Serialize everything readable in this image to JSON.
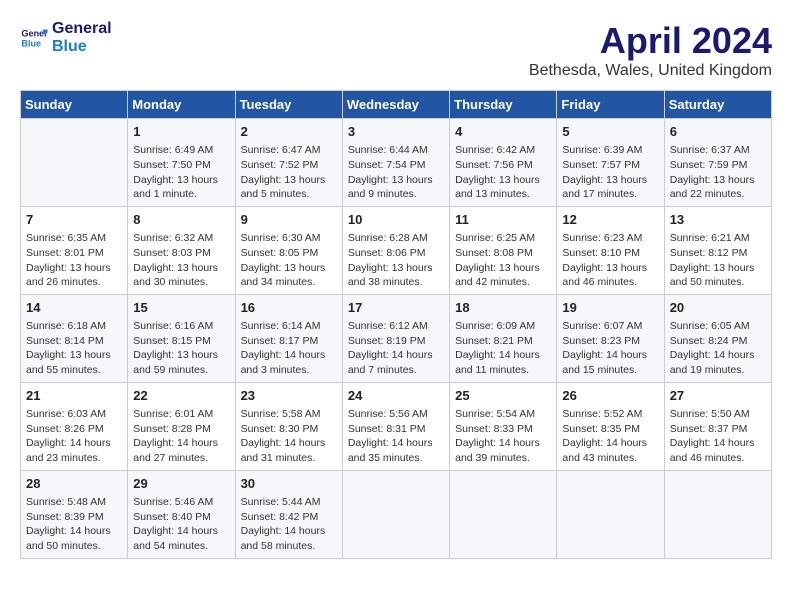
{
  "logo": {
    "line1": "General",
    "line2": "Blue"
  },
  "title": "April 2024",
  "location": "Bethesda, Wales, United Kingdom",
  "days_of_week": [
    "Sunday",
    "Monday",
    "Tuesday",
    "Wednesday",
    "Thursday",
    "Friday",
    "Saturday"
  ],
  "weeks": [
    [
      {
        "day": "",
        "info": ""
      },
      {
        "day": "1",
        "info": "Sunrise: 6:49 AM\nSunset: 7:50 PM\nDaylight: 13 hours\nand 1 minute."
      },
      {
        "day": "2",
        "info": "Sunrise: 6:47 AM\nSunset: 7:52 PM\nDaylight: 13 hours\nand 5 minutes."
      },
      {
        "day": "3",
        "info": "Sunrise: 6:44 AM\nSunset: 7:54 PM\nDaylight: 13 hours\nand 9 minutes."
      },
      {
        "day": "4",
        "info": "Sunrise: 6:42 AM\nSunset: 7:56 PM\nDaylight: 13 hours\nand 13 minutes."
      },
      {
        "day": "5",
        "info": "Sunrise: 6:39 AM\nSunset: 7:57 PM\nDaylight: 13 hours\nand 17 minutes."
      },
      {
        "day": "6",
        "info": "Sunrise: 6:37 AM\nSunset: 7:59 PM\nDaylight: 13 hours\nand 22 minutes."
      }
    ],
    [
      {
        "day": "7",
        "info": "Sunrise: 6:35 AM\nSunset: 8:01 PM\nDaylight: 13 hours\nand 26 minutes."
      },
      {
        "day": "8",
        "info": "Sunrise: 6:32 AM\nSunset: 8:03 PM\nDaylight: 13 hours\nand 30 minutes."
      },
      {
        "day": "9",
        "info": "Sunrise: 6:30 AM\nSunset: 8:05 PM\nDaylight: 13 hours\nand 34 minutes."
      },
      {
        "day": "10",
        "info": "Sunrise: 6:28 AM\nSunset: 8:06 PM\nDaylight: 13 hours\nand 38 minutes."
      },
      {
        "day": "11",
        "info": "Sunrise: 6:25 AM\nSunset: 8:08 PM\nDaylight: 13 hours\nand 42 minutes."
      },
      {
        "day": "12",
        "info": "Sunrise: 6:23 AM\nSunset: 8:10 PM\nDaylight: 13 hours\nand 46 minutes."
      },
      {
        "day": "13",
        "info": "Sunrise: 6:21 AM\nSunset: 8:12 PM\nDaylight: 13 hours\nand 50 minutes."
      }
    ],
    [
      {
        "day": "14",
        "info": "Sunrise: 6:18 AM\nSunset: 8:14 PM\nDaylight: 13 hours\nand 55 minutes."
      },
      {
        "day": "15",
        "info": "Sunrise: 6:16 AM\nSunset: 8:15 PM\nDaylight: 13 hours\nand 59 minutes."
      },
      {
        "day": "16",
        "info": "Sunrise: 6:14 AM\nSunset: 8:17 PM\nDaylight: 14 hours\nand 3 minutes."
      },
      {
        "day": "17",
        "info": "Sunrise: 6:12 AM\nSunset: 8:19 PM\nDaylight: 14 hours\nand 7 minutes."
      },
      {
        "day": "18",
        "info": "Sunrise: 6:09 AM\nSunset: 8:21 PM\nDaylight: 14 hours\nand 11 minutes."
      },
      {
        "day": "19",
        "info": "Sunrise: 6:07 AM\nSunset: 8:23 PM\nDaylight: 14 hours\nand 15 minutes."
      },
      {
        "day": "20",
        "info": "Sunrise: 6:05 AM\nSunset: 8:24 PM\nDaylight: 14 hours\nand 19 minutes."
      }
    ],
    [
      {
        "day": "21",
        "info": "Sunrise: 6:03 AM\nSunset: 8:26 PM\nDaylight: 14 hours\nand 23 minutes."
      },
      {
        "day": "22",
        "info": "Sunrise: 6:01 AM\nSunset: 8:28 PM\nDaylight: 14 hours\nand 27 minutes."
      },
      {
        "day": "23",
        "info": "Sunrise: 5:58 AM\nSunset: 8:30 PM\nDaylight: 14 hours\nand 31 minutes."
      },
      {
        "day": "24",
        "info": "Sunrise: 5:56 AM\nSunset: 8:31 PM\nDaylight: 14 hours\nand 35 minutes."
      },
      {
        "day": "25",
        "info": "Sunrise: 5:54 AM\nSunset: 8:33 PM\nDaylight: 14 hours\nand 39 minutes."
      },
      {
        "day": "26",
        "info": "Sunrise: 5:52 AM\nSunset: 8:35 PM\nDaylight: 14 hours\nand 43 minutes."
      },
      {
        "day": "27",
        "info": "Sunrise: 5:50 AM\nSunset: 8:37 PM\nDaylight: 14 hours\nand 46 minutes."
      }
    ],
    [
      {
        "day": "28",
        "info": "Sunrise: 5:48 AM\nSunset: 8:39 PM\nDaylight: 14 hours\nand 50 minutes."
      },
      {
        "day": "29",
        "info": "Sunrise: 5:46 AM\nSunset: 8:40 PM\nDaylight: 14 hours\nand 54 minutes."
      },
      {
        "day": "30",
        "info": "Sunrise: 5:44 AM\nSunset: 8:42 PM\nDaylight: 14 hours\nand 58 minutes."
      },
      {
        "day": "",
        "info": ""
      },
      {
        "day": "",
        "info": ""
      },
      {
        "day": "",
        "info": ""
      },
      {
        "day": "",
        "info": ""
      }
    ]
  ]
}
